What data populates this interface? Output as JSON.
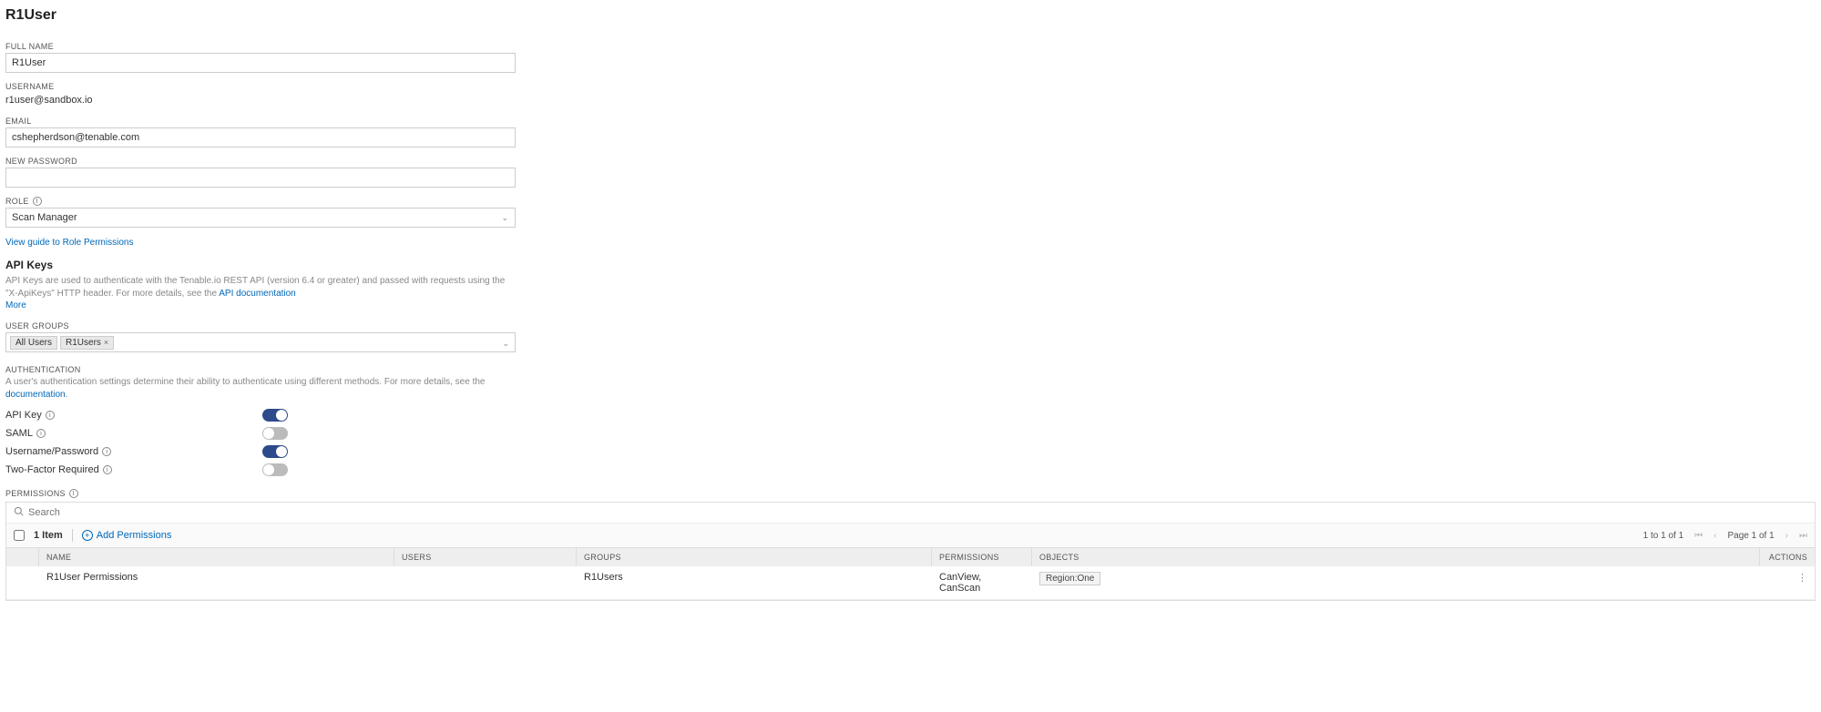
{
  "title": "R1User",
  "fields": {
    "full_name": {
      "label": "FULL NAME",
      "value": "R1User"
    },
    "username": {
      "label": "USERNAME",
      "value": "r1user@sandbox.io"
    },
    "email": {
      "label": "EMAIL",
      "value": "cshepherdson@tenable.com"
    },
    "new_password": {
      "label": "NEW PASSWORD",
      "value": ""
    },
    "role": {
      "label": "ROLE",
      "value": "Scan Manager"
    },
    "role_guide_link": "View guide to Role Permissions",
    "user_groups": {
      "label": "USER GROUPS",
      "chips": [
        "All Users",
        "R1Users"
      ]
    }
  },
  "api_keys": {
    "heading": "API Keys",
    "desc_prefix": "API Keys are used to authenticate with the Tenable.io REST API (version 6.4 or greater) and passed with requests using the \"X-ApiKeys\" HTTP header. For more details, see the ",
    "doc_link": "API documentation",
    "more": "More"
  },
  "authentication": {
    "label": "AUTHENTICATION",
    "desc_prefix": "A user's authentication settings determine their ability to authenticate using different methods. For more details, see the ",
    "doc_link": "documentation",
    "desc_suffix": ".",
    "rows": [
      {
        "label": "API Key",
        "info": true,
        "on": true
      },
      {
        "label": "SAML",
        "info": true,
        "on": false
      },
      {
        "label": "Username/Password",
        "info": true,
        "on": true
      },
      {
        "label": "Two-Factor Required",
        "info": true,
        "on": false
      }
    ]
  },
  "permissions": {
    "label": "PERMISSIONS",
    "search_placeholder": "Search",
    "count_text": "1 Item",
    "add_label": "Add Permissions",
    "range_text": "1 to 1 of 1",
    "page_text": "Page 1 of 1",
    "headers": {
      "name": "NAME",
      "users": "USERS",
      "groups": "GROUPS",
      "permissions": "PERMISSIONS",
      "objects": "OBJECTS",
      "actions": "ACTIONS"
    },
    "rows": [
      {
        "name": "R1User Permissions",
        "users": "",
        "groups": "R1Users",
        "permissions": "CanView, CanScan",
        "objects": [
          "Region:One"
        ]
      }
    ]
  }
}
